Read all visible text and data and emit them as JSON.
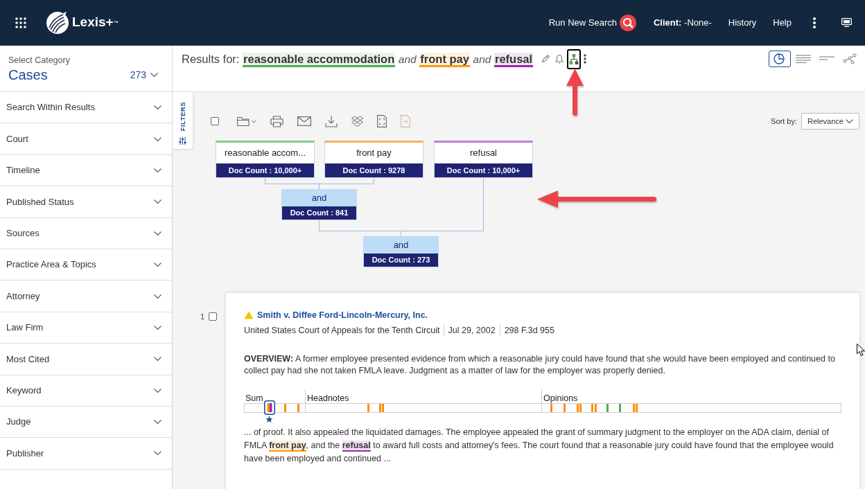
{
  "header": {
    "app_name": "Lexis+",
    "trademark": "™",
    "search_link": "Run New Search",
    "client_label": "Client:",
    "client_value": "-None-",
    "links": [
      "History",
      "Help"
    ]
  },
  "sidebar": {
    "category_label": "Select Category",
    "category": "Cases",
    "count": "273",
    "filters": [
      {
        "label": "Search Within Results",
        "expanded": false
      },
      {
        "label": "Court",
        "expanded": false
      },
      {
        "label": "Timeline",
        "expanded": false
      },
      {
        "label": "Published Status",
        "expanded": false
      },
      {
        "label": "Sources",
        "expanded": false
      },
      {
        "label": "Practice Area & Topics",
        "expanded": false
      },
      {
        "label": "Attorney",
        "expanded": false
      },
      {
        "label": "Law Firm",
        "expanded": false
      },
      {
        "label": "Most Cited",
        "expanded": false
      },
      {
        "label": "Keyword",
        "expanded": false
      },
      {
        "label": "Judge",
        "expanded": false
      },
      {
        "label": "Publisher",
        "expanded": false
      }
    ]
  },
  "results_header": {
    "label": "Results for:",
    "query": [
      {
        "kind": "term",
        "text": "reasonable accommodation",
        "color": "#4caf50"
      },
      {
        "kind": "operator",
        "text": "and"
      },
      {
        "kind": "term",
        "text": "front pay",
        "color": "#ff9800"
      },
      {
        "kind": "operator",
        "text": "and"
      },
      {
        "kind": "term",
        "text": "refusal",
        "color": "#9c27b0"
      }
    ],
    "actions": [
      {
        "kind": "edit",
        "selected": false
      },
      {
        "kind": "alert",
        "selected": false
      },
      {
        "kind": "map",
        "selected": true
      },
      {
        "kind": "more",
        "selected": false
      }
    ],
    "views": [
      {
        "kind": "chart",
        "selected": true
      },
      {
        "kind": "list",
        "selected": false
      },
      {
        "kind": "lines",
        "selected": false
      },
      {
        "kind": "graph",
        "selected": false
      }
    ]
  },
  "filters_tab": {
    "label": "FILTERS"
  },
  "toolbar": {
    "select_all": {
      "checked": false
    },
    "tools": [
      {
        "kind": "folder",
        "disabled": false
      },
      {
        "kind": "print",
        "disabled": false
      },
      {
        "kind": "email",
        "disabled": false
      },
      {
        "kind": "download",
        "disabled": false
      },
      {
        "kind": "diamonds",
        "disabled": false
      },
      {
        "kind": "document",
        "disabled": false
      },
      {
        "kind": "export",
        "disabled": true
      }
    ],
    "sort_label": "Sort by:",
    "sort_value": "Relevance"
  },
  "query_map": {
    "terms": [
      {
        "text": "reasonable accom...",
        "doc_count": "Doc Count : 10,000+",
        "color": "#8bc98a"
      },
      {
        "text": "front pay",
        "doc_count": "Doc Count : 9278",
        "color": "#f5b35c"
      },
      {
        "text": "refusal",
        "doc_count": "Doc Count : 10,000+",
        "color": "#c07ecf"
      }
    ],
    "operators": [
      {
        "text": "and",
        "doc_count": "Doc Count : 841"
      },
      {
        "text": "and",
        "doc_count": "Doc Count : 273"
      }
    ]
  },
  "results": [
    {
      "number": "1",
      "checked": false,
      "title": "Smith v. Diffee Ford-Lincoln-Mercury, Inc.",
      "court": "United States Court of Appeals for the Tenth Circuit",
      "date": "Jul 29, 2002",
      "citation": "298 F.3d 955",
      "overview": "**OVERVIEW:** A former employee presented evidence from which a reasonable jury could have found that she would have been employed and continued to collect pay had she not taken FMLA leave. Judgment as a matter of law for the employer was properly denied.",
      "segments": [
        {
          "label": "Sum"
        },
        {
          "label": "Headnotes"
        },
        {
          "label": "Opinions"
        }
      ],
      "snippet": [
        {
          "kind": "text",
          "text": "... of proof. It also appealed the liquidated damages. The employee appealed the grant of summary judgment to the employer on the ADA claim, denial of FMLA "
        },
        {
          "kind": "highlight",
          "text": "front pay",
          "color": "#ff8f00"
        },
        {
          "kind": "text",
          "text": ", and the "
        },
        {
          "kind": "highlight",
          "text": "refusal",
          "color": "#9c27b0"
        },
        {
          "kind": "text",
          "text": " to award full costs and attorney's fees. The court found that a reasonable jury could have found that the employee would have been employed and continued ..."
        }
      ]
    }
  ]
}
